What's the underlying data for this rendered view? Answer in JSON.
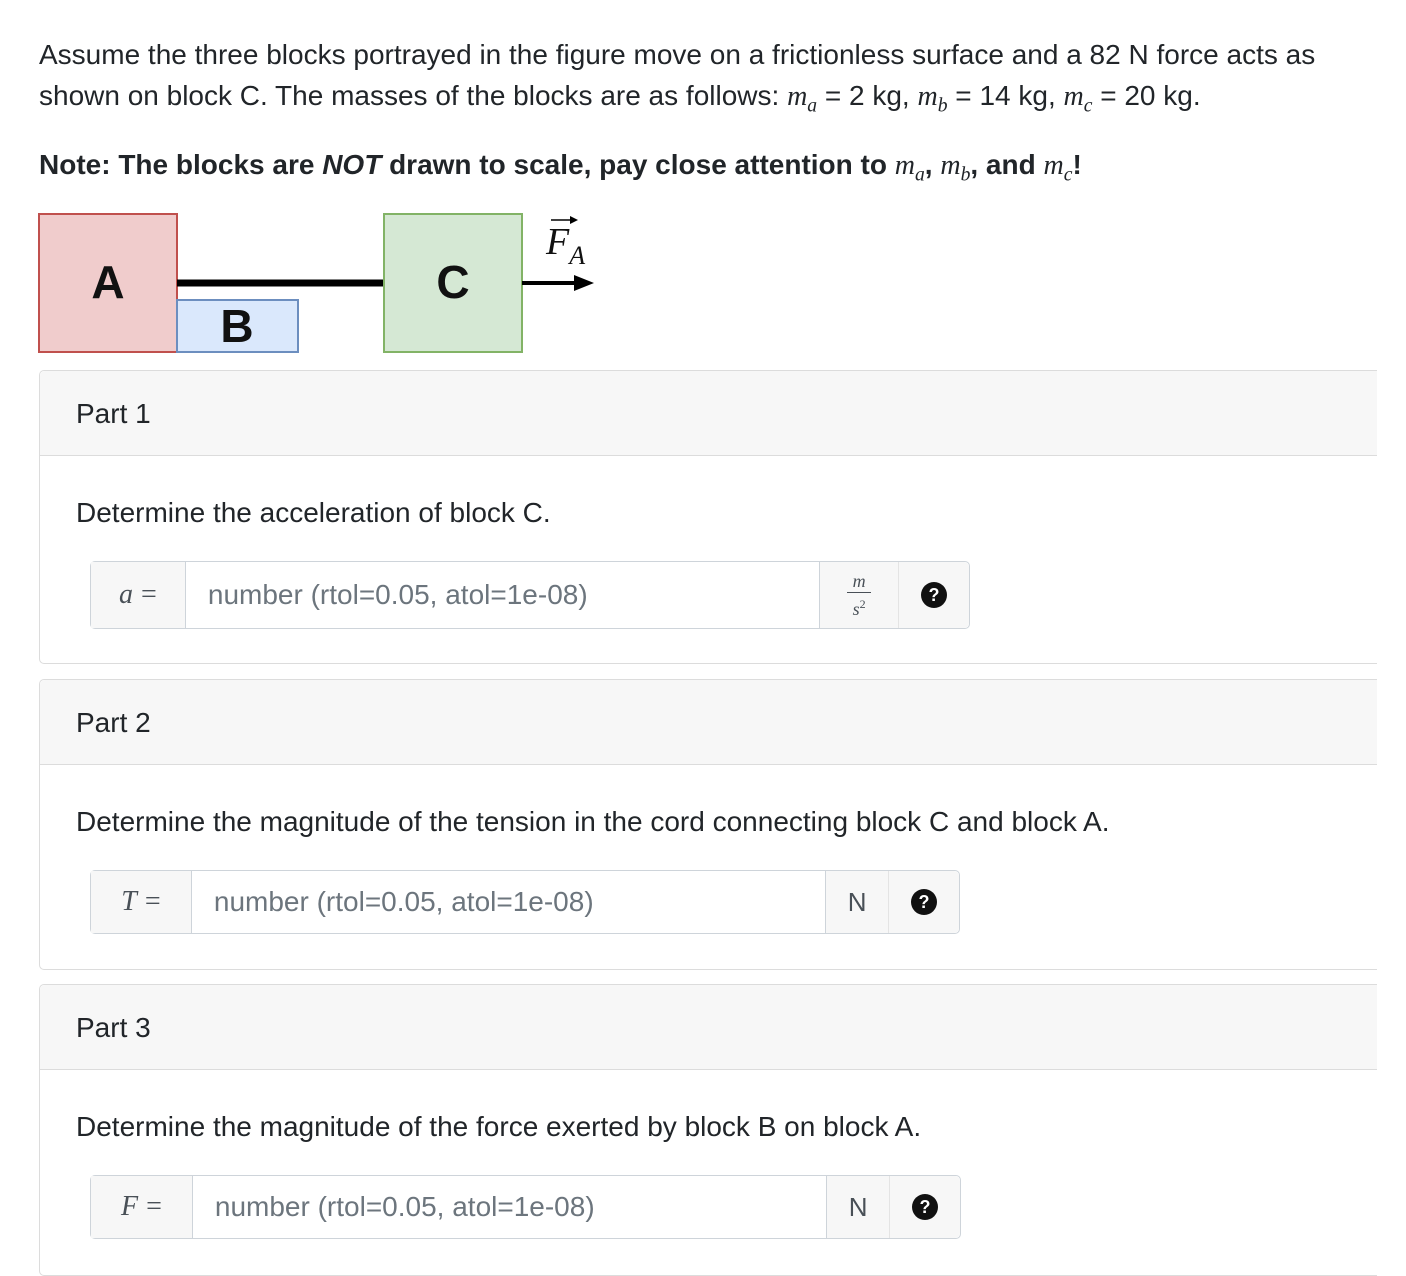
{
  "intro": {
    "line_before": "Assume the three blocks portrayed in the figure move on a frictionless surface and a 82 N force acts as shown on block C. The masses of the blocks are as follows: ",
    "ma_sym": "m",
    "ma_sub": "a",
    "ma_val": " = 2 kg, ",
    "mb_sym": "m",
    "mb_sub": "b",
    "mb_val": " = 14 kg, ",
    "mc_sym": "m",
    "mc_sub": "c",
    "mc_val": " = 20 kg."
  },
  "note": {
    "prefix": "Note: The blocks are ",
    "emph": "NOT",
    "middle": " drawn to scale, pay close attention to ",
    "sym": "m",
    "sub_a": "a",
    "sep1": ", ",
    "sub_b": "b",
    "sep2": ", and ",
    "sub_c": "c",
    "suffix": "!"
  },
  "figure": {
    "block_a": "A",
    "block_b": "B",
    "block_c": "C",
    "force_letter": "F",
    "force_sub": "A",
    "colors": {
      "a_fill": "#f0cccc",
      "a_stroke": "#c0504d",
      "b_fill": "#dae8fc",
      "b_stroke": "#6c8ebf",
      "c_fill": "#d5e8d4",
      "c_stroke": "#82b366"
    }
  },
  "parts": [
    {
      "title": "Part 1",
      "question": "Determine the acceleration of block C.",
      "var": "a",
      "eq": "=",
      "placeholder": "number (rtol=0.05, atol=1e-08)",
      "unit_num": "m",
      "unit_den": "s",
      "unit_exp": "2",
      "help": "?"
    },
    {
      "title": "Part 2",
      "question": "Determine the magnitude of the tension in the cord connecting block C and block A.",
      "var": "T",
      "eq": "=",
      "placeholder": "number (rtol=0.05, atol=1e-08)",
      "unit": "N",
      "help": "?"
    },
    {
      "title": "Part 3",
      "question": "Determine the magnitude of the force exerted by block B on block A.",
      "var": "F",
      "eq": "=",
      "placeholder": "number (rtol=0.05, atol=1e-08)",
      "unit": "N",
      "help": "?"
    }
  ]
}
